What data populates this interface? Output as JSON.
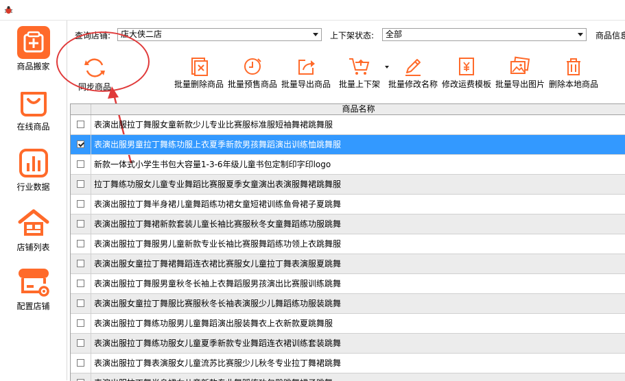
{
  "sidebar": {
    "items": [
      {
        "label": "商品搬家",
        "icon": "transfer-icon"
      },
      {
        "label": "在线商品",
        "icon": "shopping-bag-icon"
      },
      {
        "label": "行业数据",
        "icon": "bar-chart-icon"
      },
      {
        "label": "店铺列表",
        "icon": "store-icon"
      },
      {
        "label": "配置店铺",
        "icon": "store-settings-icon"
      }
    ]
  },
  "filters": {
    "store_label": "查询店铺:",
    "store_value": "店大侠二店",
    "status_label": "上下架状态:",
    "status_value": "全部",
    "info_label": "商品信息"
  },
  "toolbar": {
    "sync": "同步商品",
    "batch_delete": "批量删除商品",
    "batch_presale": "批量预售商品",
    "batch_export": "批量导出商品",
    "batch_shelf": "批量上下架",
    "batch_rename": "批量修改名称",
    "modify_freight": "修改运费模板",
    "batch_export_images": "批量导出图片",
    "delete_local": "删除本地商品"
  },
  "grid": {
    "column_name": "商品名称",
    "rows": [
      {
        "name": "表演出服拉丁舞服女童新款少儿专业比赛服标准服短袖舞裙跳舞服",
        "checked": false,
        "selected": false
      },
      {
        "name": "表演出服男童拉丁舞练功服上衣夏季新款男孩舞蹈演出训练恤跳舞服",
        "checked": true,
        "selected": true
      },
      {
        "name": "新款一体式小学生书包大容量1-3-6年级儿童书包定制印字印logo",
        "checked": false,
        "selected": false
      },
      {
        "name": "拉丁舞练功服女儿童专业舞蹈比赛服夏季女童演出表演服舞裙跳舞服",
        "checked": false,
        "selected": false
      },
      {
        "name": "表演出服拉丁舞半身裙儿童舞蹈练功裙女童短裙训练鱼骨裙子夏跳舞",
        "checked": false,
        "selected": false
      },
      {
        "name": "表演出服拉丁舞裙新款套装儿童长袖比赛服秋冬女童舞蹈练功服跳舞",
        "checked": false,
        "selected": false
      },
      {
        "name": "表演出服拉丁舞服男儿童新款专业长袖比赛服舞蹈练功领上衣跳舞服",
        "checked": false,
        "selected": false
      },
      {
        "name": "表演出服女童拉丁舞裙舞蹈连衣裙比赛服女儿童拉丁舞表演服夏跳舞",
        "checked": false,
        "selected": false
      },
      {
        "name": "表演出服拉丁舞服男童秋冬长袖上衣舞蹈服男孩演出比赛服训练跳舞",
        "checked": false,
        "selected": false
      },
      {
        "name": "表演出服女童拉丁舞服比赛服秋冬长袖表演服少儿舞蹈练功服装跳舞",
        "checked": false,
        "selected": false
      },
      {
        "name": "表演出服拉丁舞练功服男儿童舞蹈演出服装舞衣上衣新款夏跳舞服",
        "checked": false,
        "selected": false
      },
      {
        "name": "表演出服拉丁舞练功服女儿童夏季新款专业舞蹈连衣裙训练套装跳舞",
        "checked": false,
        "selected": false
      },
      {
        "name": "表演出服拉丁舞表演服女儿童流苏比赛服少儿秋冬专业拉丁舞裙跳舞",
        "checked": false,
        "selected": false
      },
      {
        "name": "表演出服拉丁舞半身裙女儿童新款专业舞蹈练功包臀跳舞裙子跳舞",
        "checked": false,
        "selected": false
      }
    ]
  },
  "colors": {
    "accent": "#ff6a2a",
    "annotation": "#e03a3a",
    "selection": "#3399ff"
  }
}
